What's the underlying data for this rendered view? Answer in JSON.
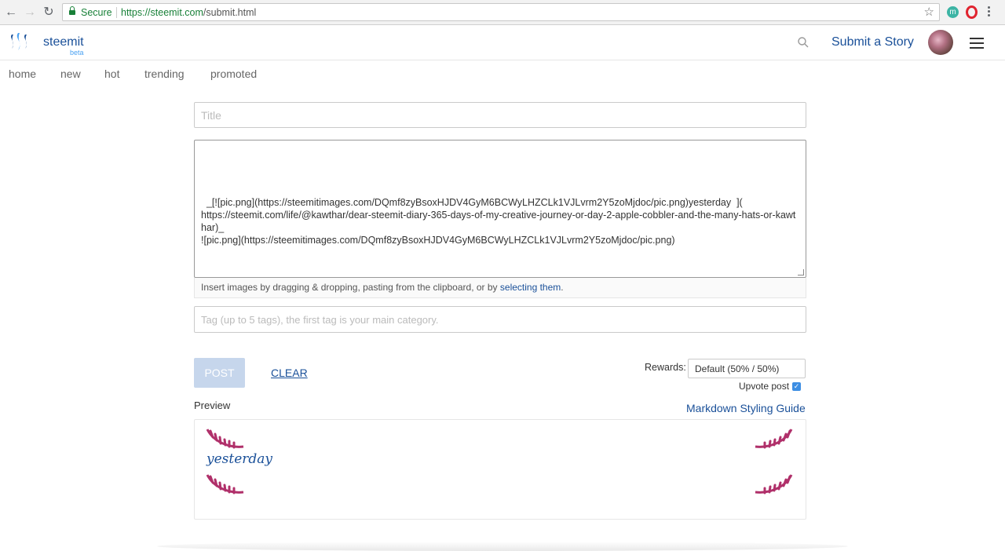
{
  "browser": {
    "secure_label": "Secure",
    "url_host": "https://steemit.com",
    "url_path": "/submit.html",
    "ext_letter": "m"
  },
  "header": {
    "brand": "steemit",
    "beta": "beta",
    "submit_story": "Submit a Story"
  },
  "subnav": [
    "home",
    "new",
    "hot",
    "trending",
    "promoted"
  ],
  "editor": {
    "title_placeholder": "Title",
    "body_text": "_[![pic.png](https://steemitimages.com/DQmf8zyBsoxHJDV4GyM6BCWyLHZCLk1VJLvrm2Y5zoMjdoc/pic.png)yesterday  ](\nhttps://steemit.com/life/@kawthar/dear-steemit-diary-365-days-of-my-creative-journey-or-day-2-apple-cobbler-and-the-many-hats-or-kawthar)_\n![pic.png](https://steemitimages.com/DQmf8zyBsoxHJDV4GyM6BCWyLHZCLk1VJLvrm2Y5zoMjdoc/pic.png)",
    "dropzone_text": "Insert images by dragging & dropping, pasting from the clipboard, or by ",
    "dropzone_link": "selecting them",
    "dropzone_end": ".",
    "tag_placeholder": "Tag (up to 5 tags), the first tag is your main category."
  },
  "actions": {
    "post": "POST",
    "clear": "CLEAR",
    "rewards_label": "Rewards:",
    "rewards_value": "Default (50% / 50%)",
    "upvote_label": "Upvote post",
    "upvote_checked": true
  },
  "preview": {
    "label": "Preview",
    "guide_link": "Markdown Styling Guide",
    "link_text": "yesterday"
  },
  "colors": {
    "link": "#1a5099",
    "pic": "#b0306a"
  }
}
